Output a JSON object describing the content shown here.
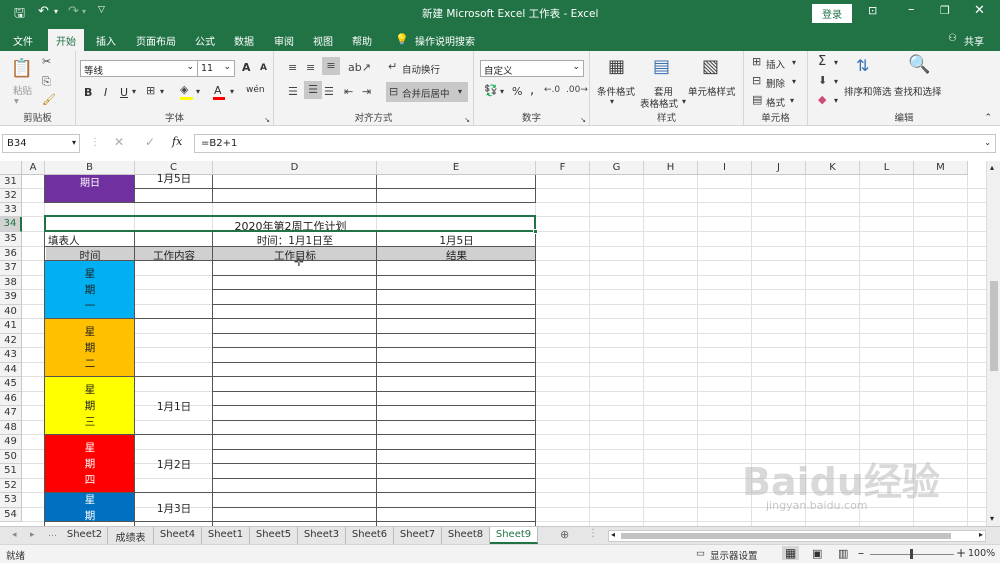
{
  "window": {
    "title": "新建 Microsoft Excel 工作表 - Excel",
    "login": "登录"
  },
  "quick_access": {
    "save": "save-icon",
    "undo": "undo-icon",
    "redo": "redo-icon",
    "customize": "▽"
  },
  "ribbon_tabs": [
    "文件",
    "开始",
    "插入",
    "页面布局",
    "公式",
    "数据",
    "审阅",
    "视图",
    "帮助"
  ],
  "tell_me": "操作说明搜索",
  "share": "共享",
  "ribbon": {
    "clipboard": {
      "label": "剪贴板",
      "paste": "粘贴"
    },
    "font": {
      "label": "字体",
      "name": "等线",
      "size": "11",
      "bold": "B",
      "italic": "I",
      "underline": "U",
      "grow": "A",
      "shrink": "A",
      "phonetic": "wén",
      "colors": {
        "fill": "#ffff00",
        "font": "#ff0000"
      }
    },
    "alignment": {
      "label": "对齐方式",
      "wrap": "自动换行",
      "merge": "合并后居中"
    },
    "number": {
      "label": "数字",
      "format": "自定义",
      "percent": "%",
      "comma": ","
    },
    "styles": {
      "label": "样式",
      "conditional": "条件格式",
      "table_l1": "套用",
      "table_l2": "表格格式",
      "cell": "单元格样式"
    },
    "cells": {
      "label": "单元格",
      "insert": "插入",
      "delete": "删除",
      "format": "格式"
    },
    "editing": {
      "label": "编辑",
      "sum": "Σ",
      "sort": "排序和筛选",
      "find": "查找和选择"
    }
  },
  "formula_bar": {
    "namebox": "B34",
    "fx": "fx",
    "formula": "=B2+1"
  },
  "columns": [
    "A",
    "B",
    "C",
    "D",
    "E",
    "F",
    "G",
    "H",
    "I",
    "J",
    "K",
    "L",
    "M"
  ],
  "rows": [
    "31",
    "32",
    "33",
    "34",
    "35",
    "36",
    "37",
    "38",
    "39",
    "40",
    "41",
    "42",
    "43",
    "44",
    "45",
    "46",
    "47",
    "48",
    "49",
    "50",
    "51",
    "52",
    "53",
    "54"
  ],
  "cells": {
    "b31": "1月5日",
    "a31": "期日",
    "title": "2020年第2周工作计划",
    "filler": "填表人",
    "time_label": "时间：1月1日至",
    "end_date": "1月5日",
    "headers": [
      "时间",
      "工作内容",
      "工作目标",
      "结果"
    ],
    "days": [
      {
        "label": "星期一",
        "chars": [
          "星",
          "期",
          "一"
        ],
        "date": "",
        "color": "#00b0f0"
      },
      {
        "label": "星期二",
        "chars": [
          "星",
          "期",
          "二"
        ],
        "date": "",
        "color": "#ffc000"
      },
      {
        "label": "星期三",
        "chars": [
          "星",
          "期",
          "三"
        ],
        "date": "1月1日",
        "color": "#ffff00"
      },
      {
        "label": "星期四",
        "chars": [
          "星",
          "期",
          "四"
        ],
        "date": "1月2日",
        "color": "#ff0000"
      },
      {
        "label": "星期五",
        "chars": [
          "星",
          "期"
        ],
        "date": "1月3日",
        "color": "#0070c0"
      }
    ],
    "a31_color": "#7030a0"
  },
  "sheet_tabs": [
    "Sheet2",
    "成绩表",
    "Sheet4",
    "Sheet1",
    "Sheet5",
    "Sheet3",
    "Sheet6",
    "Sheet7",
    "Sheet8",
    "Sheet9"
  ],
  "active_sheet": "Sheet9",
  "status": {
    "left": "就绪",
    "display": "显示器设置",
    "zoom": "100%"
  },
  "watermark": {
    "brand": "Baidu经验",
    "url": "jingyan.baidu.com"
  }
}
